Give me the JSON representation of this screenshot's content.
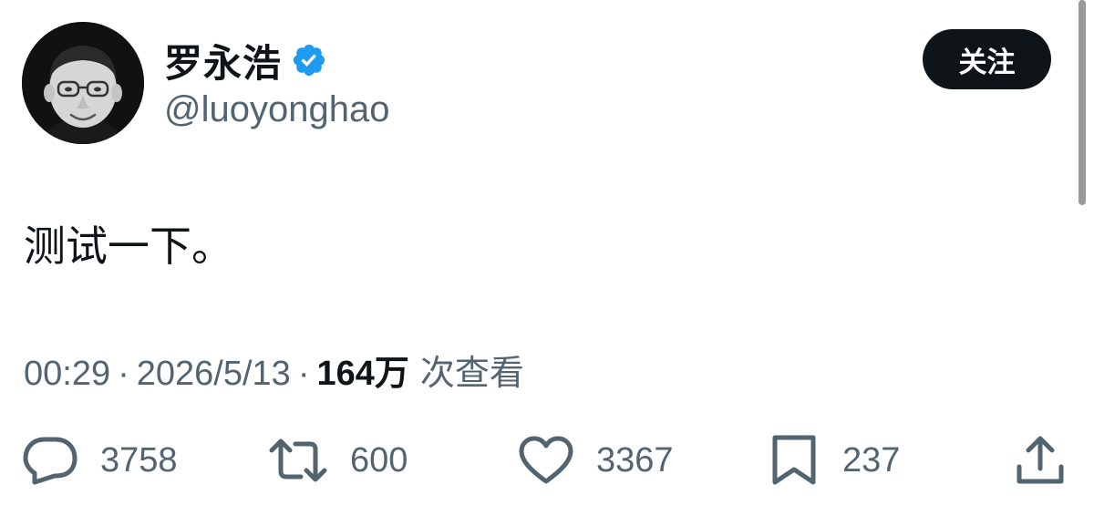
{
  "author": {
    "display_name": "罗永浩",
    "handle": "@luoyonghao",
    "verified_icon": "verified-badge-icon",
    "avatar": "avatar-photo"
  },
  "follow_label": "关注",
  "tweet": {
    "text": "测试一下。",
    "time": "00:29",
    "separator": "·",
    "date": "2026/5/13",
    "views_count": "164万",
    "views_label": "次查看"
  },
  "actions": {
    "reply": {
      "icon": "reply-icon",
      "count": "3758"
    },
    "retweet": {
      "icon": "retweet-icon",
      "count": "600"
    },
    "like": {
      "icon": "heart-icon",
      "count": "3367"
    },
    "bookmark": {
      "icon": "bookmark-icon",
      "count": "237"
    },
    "share": {
      "icon": "share-icon"
    }
  },
  "colors": {
    "primary_text": "#0f1419",
    "secondary_text": "#536471",
    "verified_blue": "#1d9bf0",
    "follow_button_bg": "#0f1419"
  }
}
